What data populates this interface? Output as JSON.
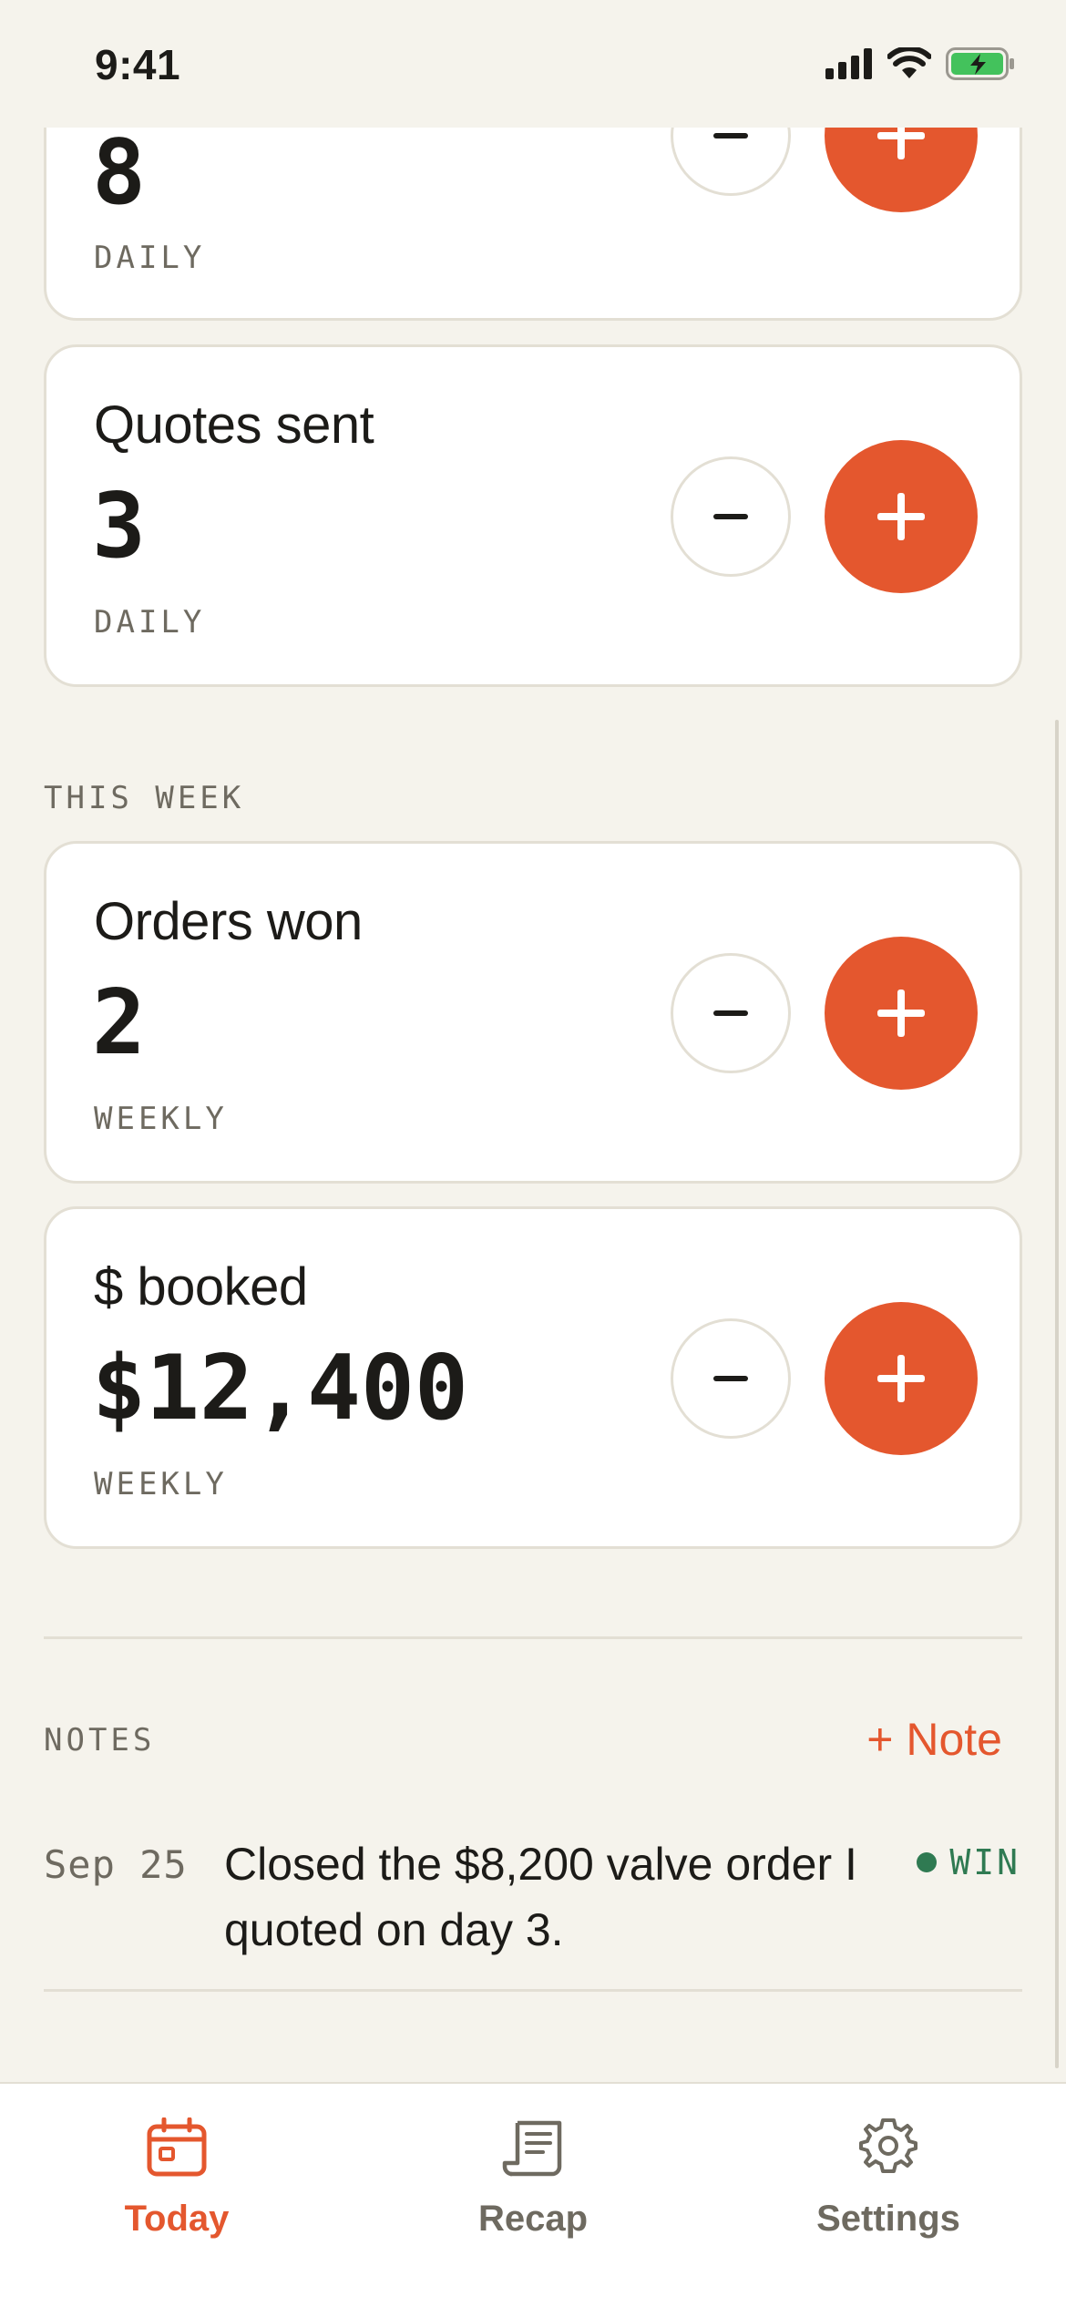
{
  "status_bar": {
    "time": "9:41"
  },
  "colors": {
    "accent": "#e4572e",
    "win": "#2f7a52",
    "background": "#f5f3ec"
  },
  "cards_top": [
    {
      "value": "8",
      "period": "DAILY"
    },
    {
      "title": "Quotes sent",
      "value": "3",
      "period": "DAILY"
    }
  ],
  "this_week": {
    "label": "THIS WEEK",
    "cards": [
      {
        "title": "Orders won",
        "value": "2",
        "period": "WEEKLY"
      },
      {
        "title": "$ booked",
        "value": "$12,400",
        "period": "WEEKLY"
      }
    ]
  },
  "notes": {
    "label": "NOTES",
    "add_label": "+ Note",
    "items": [
      {
        "date": "Sep 25",
        "text": "Closed the $8,200 valve order I quoted on day 3.",
        "tag": "WIN"
      }
    ]
  },
  "tabs": [
    {
      "label": "Today",
      "icon": "calendar-icon",
      "active": true
    },
    {
      "label": "Recap",
      "icon": "receipt-icon",
      "active": false
    },
    {
      "label": "Settings",
      "icon": "gear-icon",
      "active": false
    }
  ]
}
